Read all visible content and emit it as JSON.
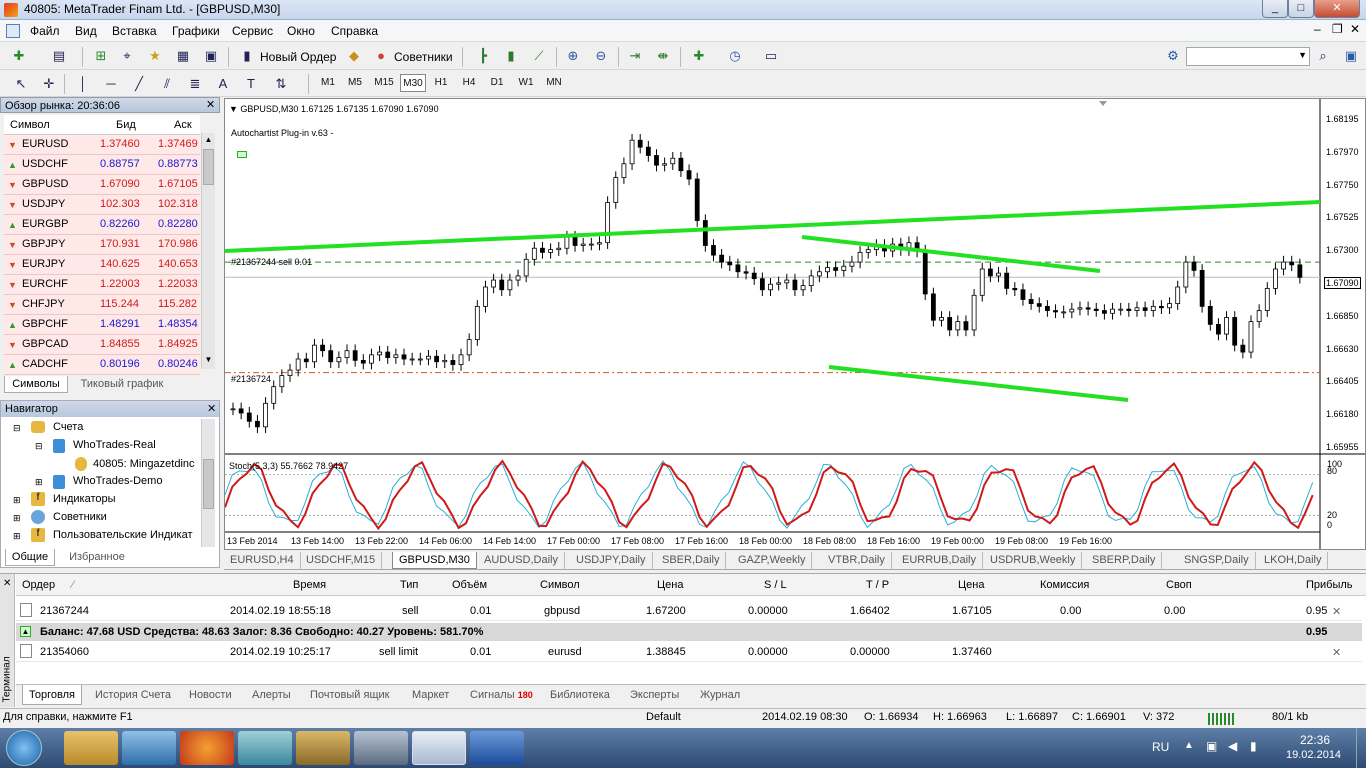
{
  "window": {
    "title": "40805: MetaTrader Finam Ltd. - [GBPUSD,M30]"
  },
  "menu": [
    "Файл",
    "Вид",
    "Вставка",
    "Графики",
    "Сервис",
    "Окно",
    "Справка"
  ],
  "toolbar": {
    "new_order": "Новый Ордер",
    "experts": "Советники"
  },
  "timeframes": [
    "M1",
    "M5",
    "M15",
    "M30",
    "H1",
    "H4",
    "D1",
    "W1",
    "MN"
  ],
  "market_watch": {
    "title": "Обзор рынка: 20:36:06",
    "headers": [
      "Символ",
      "Бид",
      "Аск"
    ],
    "rows": [
      {
        "s": "EURUSD",
        "bid": "1.37460",
        "ask": "1.37469",
        "dir": "down"
      },
      {
        "s": "USDCHF",
        "bid": "0.88757",
        "ask": "0.88773",
        "dir": "up"
      },
      {
        "s": "GBPUSD",
        "bid": "1.67090",
        "ask": "1.67105",
        "dir": "down"
      },
      {
        "s": "USDJPY",
        "bid": "102.303",
        "ask": "102.318",
        "dir": "down"
      },
      {
        "s": "EURGBP",
        "bid": "0.82260",
        "ask": "0.82280",
        "dir": "up"
      },
      {
        "s": "GBPJPY",
        "bid": "170.931",
        "ask": "170.986",
        "dir": "down"
      },
      {
        "s": "EURJPY",
        "bid": "140.625",
        "ask": "140.653",
        "dir": "down"
      },
      {
        "s": "EURCHF",
        "bid": "1.22003",
        "ask": "1.22033",
        "dir": "down"
      },
      {
        "s": "CHFJPY",
        "bid": "115.244",
        "ask": "115.282",
        "dir": "down"
      },
      {
        "s": "GBPCHF",
        "bid": "1.48291",
        "ask": "1.48354",
        "dir": "up"
      },
      {
        "s": "GBPCAD",
        "bid": "1.84855",
        "ask": "1.84925",
        "dir": "down"
      },
      {
        "s": "CADCHF",
        "bid": "0.80196",
        "ask": "0.80246",
        "dir": "up"
      }
    ],
    "tabs": [
      "Символы",
      "Тиковый график"
    ]
  },
  "navigator": {
    "title": "Навигатор",
    "items": [
      "Счета",
      "WhoTrades-Real",
      "40805: Mingazetdinc",
      "WhoTrades-Demo",
      "Индикаторы",
      "Советники",
      "Пользовательские Индикат"
    ],
    "tabs": [
      "Общие",
      "Избранное"
    ]
  },
  "chart": {
    "header": "GBPUSD,M30  1.67125 1.67135 1.67090 1.67090",
    "plugin": "Autochartist Plug-in v.63 -",
    "order_label": "#21367244 sell 0.01",
    "order_label2": "#2136724",
    "price_labels": [
      "1.68195",
      "1.67970",
      "1.67750",
      "1.67525",
      "1.67300",
      "1.67090",
      "1.66850",
      "1.66630",
      "1.66405",
      "1.66180",
      "1.65955"
    ],
    "current_price": "1.67090",
    "stoch_label": "Stoch(5,3,3) 55.7662 78.9427",
    "stoch_levels": [
      "100",
      "80",
      "20",
      "0"
    ],
    "time_labels": [
      "13 Feb 2014",
      "13 Feb 14:00",
      "13 Feb 22:00",
      "14 Feb 06:00",
      "14 Feb 14:00",
      "17 Feb 00:00",
      "17 Feb 08:00",
      "17 Feb 16:00",
      "18 Feb 00:00",
      "18 Feb 08:00",
      "18 Feb 16:00",
      "19 Feb 00:00",
      "19 Feb 08:00",
      "19 Feb 16:00"
    ]
  },
  "chart_tabs": [
    "EURUSD,H4",
    "USDCHF,M15",
    "GBPUSD,M30",
    "AUDUSD,Daily",
    "USDJPY,Daily",
    "SBER,Daily",
    "GAZP,Weekly",
    "VTBR,Daily",
    "EURRUB,Daily",
    "USDRUB,Weekly",
    "SBERP,Daily",
    "SNGSP,Daily",
    "LKOH,Daily"
  ],
  "terminal": {
    "side_label": "Терминал",
    "headers": [
      "Ордер",
      "Время",
      "Тип",
      "Объём",
      "Символ",
      "Цена",
      "S / L",
      "T / P",
      "Цена",
      "Комиссия",
      "Своп",
      "Прибыль"
    ],
    "rows": [
      [
        "21367244",
        "2014.02.19 18:55:18",
        "sell",
        "0.01",
        "gbpusd",
        "1.67200",
        "0.00000",
        "1.66402",
        "1.67105",
        "0.00",
        "0.00",
        "0.95"
      ],
      [
        "21354060",
        "2014.02.19 10:25:17",
        "sell limit",
        "0.01",
        "eurusd",
        "1.38845",
        "0.00000",
        "0.00000",
        "1.37460",
        "",
        "",
        ""
      ]
    ],
    "balance": "Баланс: 47.68 USD  Средства: 48.63  Залог: 8.36  Свободно: 40.27  Уровень: 581.70%",
    "balance_profit": "0.95",
    "tabs": [
      "Торговля",
      "История Счета",
      "Новости",
      "Алерты",
      "Почтовый ящик",
      "Маркет",
      "Сигналы",
      "Библиотека",
      "Эксперты",
      "Журнал"
    ],
    "signals_badge": "180"
  },
  "status": {
    "help": "Для справки, нажмите F1",
    "profile": "Default",
    "time": "2014.02.19 08:30",
    "open": "O: 1.66934",
    "high": "H: 1.66963",
    "low": "L: 1.66897",
    "close": "C: 1.66901",
    "volume": "V: 372",
    "traffic": "80/1 kb"
  },
  "taskbar": {
    "lang": "RU",
    "clock_time": "22:36",
    "clock_date": "19.02.2014"
  },
  "chart_data": {
    "type": "line",
    "price_range": [
      1.6585,
      1.6832
    ],
    "series": [
      {
        "values": [
          1.6614,
          1.6611,
          1.6605,
          1.6601,
          1.6618,
          1.663,
          1.6638,
          1.6642,
          1.665,
          1.6648,
          1.666,
          1.6656,
          1.6648,
          1.6651,
          1.6656,
          1.6649,
          1.6647,
          1.6653,
          1.6655,
          1.6651,
          1.6653,
          1.665,
          1.665,
          1.665,
          1.6652,
          1.6648,
          1.6649,
          1.6646,
          1.6653,
          1.6664,
          1.6688,
          1.6702,
          1.6707,
          1.67,
          1.6707,
          1.671,
          1.6722,
          1.673,
          1.6727,
          1.6729,
          1.673,
          1.6738,
          1.6732,
          1.6733,
          1.6733,
          1.6734,
          1.6763,
          1.6781,
          1.6791,
          1.6808,
          1.6803,
          1.6797,
          1.679,
          1.6791,
          1.6795,
          1.6786,
          1.678,
          1.675,
          1.6732,
          1.6725,
          1.672,
          1.6718,
          1.6713,
          1.6712,
          1.6708,
          1.67,
          1.6704,
          1.6705,
          1.6707,
          1.67,
          1.6703,
          1.671,
          1.6713,
          1.6716,
          1.6714,
          1.6717,
          1.672,
          1.6727,
          1.6729,
          1.6732,
          1.6728,
          1.6733,
          1.6729,
          1.6734,
          1.6728,
          1.6697,
          1.6678,
          1.668,
          1.6671,
          1.6677,
          1.6671,
          1.6696,
          1.6715,
          1.671,
          1.6712,
          1.6701,
          1.67,
          1.6693,
          1.669,
          1.6688,
          1.6685,
          1.6684,
          1.6684,
          1.6686,
          1.6687,
          1.6686,
          1.6685,
          1.6683,
          1.6686,
          1.6686,
          1.6685,
          1.6687,
          1.6685,
          1.6688,
          1.6687,
          1.669,
          1.6702,
          1.672,
          1.6714,
          1.6688,
          1.6675,
          1.6668,
          1.668,
          1.666,
          1.6655,
          1.6677,
          1.6685,
          1.6701,
          1.6715,
          1.672,
          1.6718,
          1.6709
        ]
      }
    ]
  }
}
